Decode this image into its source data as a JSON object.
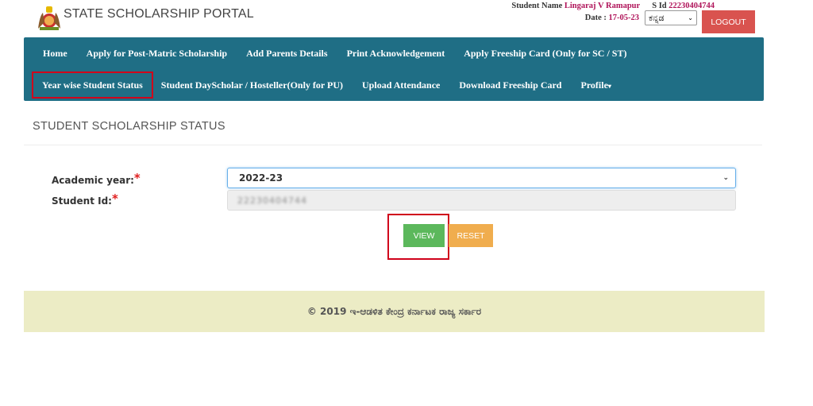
{
  "header": {
    "logo_icon": "karnataka-emblem-icon",
    "brand": "STATE SCHOLARSHIP PORTAL",
    "student_name_label": "Student Name",
    "student_name": "Lingaraj V Ramapur",
    "sid_label": "S Id",
    "sid": "22230404744",
    "date_label": "Date :",
    "date": "17-05-23",
    "language": "ಕನ್ನಡ",
    "logout_label": "LOGOUT"
  },
  "nav": {
    "row1": [
      "Home",
      "Apply for Post-Matric Scholarship",
      "Add Parents Details",
      "Print Acknowledgement",
      "Apply Freeship Card (Only for SC / ST)"
    ],
    "row2": [
      "Year wise Student Status",
      "Student DayScholar / Hosteller(Only for PU)",
      "Upload Attendance",
      "Download Freeship Card",
      "Profile"
    ],
    "profile_caret": "▾"
  },
  "main": {
    "title": "STUDENT SCHOLARSHIP STATUS",
    "academic_year_label": "Academic year:",
    "academic_year_value": "2022-23",
    "student_id_label": "Student Id:",
    "student_id_value": "22230404744",
    "required_mark": "*",
    "view_label": "VIEW",
    "reset_label": "RESET"
  },
  "footer": {
    "text": "© 2019 ಇ-ಆಡಳಿತ ಕೇಂದ್ರ ಕರ್ನಾಟಕ ರಾಜ್ಯ ಸರ್ಕಾರ"
  },
  "colors": {
    "navbar": "#1f6e85",
    "highlight": "#d0021b",
    "view": "#5cb85c",
    "reset": "#f0ad4e",
    "logout": "#d9534f",
    "footer": "#ececc5"
  }
}
